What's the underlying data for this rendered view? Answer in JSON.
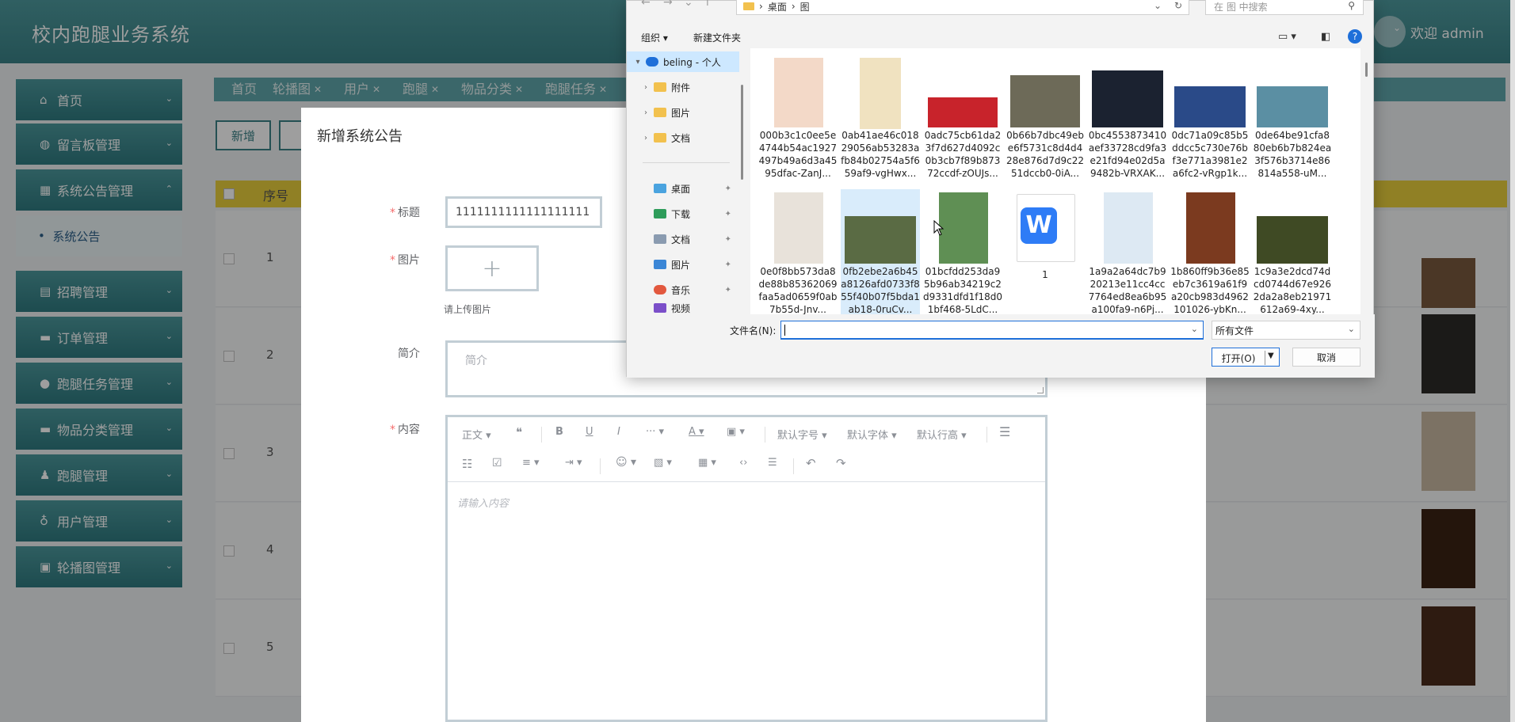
{
  "app": {
    "title": "校内跑腿业务系统",
    "welcome": "欢迎 admin"
  },
  "sidebar": {
    "items": [
      {
        "label": "首页",
        "icon": "home-icon",
        "glyph": "⌂"
      },
      {
        "label": "留言板管理",
        "icon": "chat-icon",
        "glyph": "◍"
      },
      {
        "label": "系统公告管理",
        "icon": "grid-icon",
        "glyph": "▦"
      },
      {
        "label": "招聘管理",
        "icon": "list-icon",
        "glyph": "▤"
      },
      {
        "label": "订单管理",
        "icon": "card-icon",
        "glyph": "▬"
      },
      {
        "label": "跑腿任务管理",
        "icon": "drop-icon",
        "glyph": "●"
      },
      {
        "label": "物品分类管理",
        "icon": "card-icon",
        "glyph": "▬"
      },
      {
        "label": "跑腿管理",
        "icon": "user-icon",
        "glyph": "♟"
      },
      {
        "label": "用户管理",
        "icon": "bell-icon",
        "glyph": "♁"
      },
      {
        "label": "轮播图管理",
        "icon": "image-icon",
        "glyph": "▣"
      }
    ],
    "sub_item": "系统公告"
  },
  "tabs": [
    "首页",
    "轮播图",
    "用户",
    "跑腿",
    "物品分类",
    "跑腿任务"
  ],
  "list": {
    "add_label": "新增",
    "index_header": "序号",
    "rows": [
      "1",
      "2",
      "3",
      "4",
      "5"
    ]
  },
  "dialog": {
    "title": "新增系统公告",
    "labels": {
      "title": "标题",
      "image": "图片",
      "summary": "简介",
      "content": "内容"
    },
    "required_mark": "*",
    "title_value": "1111111111111111111",
    "upload_tip": "请上传图片",
    "summary_placeholder": "简介",
    "content_placeholder": "请输入内容",
    "toolbar": {
      "paragraph": "正文",
      "font_size": "默认字号",
      "font_family": "默认字体",
      "line_height": "默认行高"
    }
  },
  "picker": {
    "breadcrumb": [
      "桌面",
      "图"
    ],
    "search_placeholder": "在 图 中搜索",
    "organize": "组织",
    "new_folder": "新建文件夹",
    "nav": [
      {
        "label": "beling - 个人",
        "type": "cloud"
      },
      {
        "label": "附件",
        "type": "folder"
      },
      {
        "label": "图片",
        "type": "folder"
      },
      {
        "label": "文档",
        "type": "folder"
      },
      {
        "label": "桌面",
        "type": "desktop"
      },
      {
        "label": "下载",
        "type": "download"
      },
      {
        "label": "文档",
        "type": "doc"
      },
      {
        "label": "图片",
        "type": "pictures"
      },
      {
        "label": "音乐",
        "type": "music"
      },
      {
        "label": "视频",
        "type": "video"
      }
    ],
    "files": [
      {
        "name": "000b3c1c0ee5e4744b54ac1927497b49a6d3a4595dfac-ZanJ...",
        "color": "#f3d9c8"
      },
      {
        "name": "0ab41ae46c01829056ab53283afb84b02754a5f659af9-vgHwx...",
        "color": "#f0e2c0"
      },
      {
        "name": "0adc75cb61da23f7d627d4092c0b3cb7f89b87372ccdf-zOUJs...",
        "color": "#c8232b"
      },
      {
        "name": "0b66b7dbc49ebe6f5731c8d4d428e876d7d9c2251dccb0-0iA...",
        "color": "#6d6a58"
      },
      {
        "name": "0bc4553873410aef33728cd9fa3e21fd94e02d5a9482b-VRXAK...",
        "color": "#1b2230"
      },
      {
        "name": "0dc71a09c85b5ddcc5c730e76bf3e771a3981e2a6fc2-vRgp1k...",
        "color": "#2a4a88"
      },
      {
        "name": "0de64be91cfa880eb6b7b824ea3f576b3714e86814a558-uM...",
        "color": "#5b8fa3"
      },
      {
        "name": "0e0f8bb573da8de88b85362069faa5ad0659f0ab7b55d-Jnv...",
        "color": "#e8e2da"
      },
      {
        "name": "0fb2ebe2a6b45a8126afd0733f855f40b07f5bda1ab18-0ruCv...",
        "color": "#5a6b44"
      },
      {
        "name": "01bcfdd253da95b96ab34219c2d9331dfd1f18d01bf468-5LdC...",
        "color": "#5f8f54"
      },
      {
        "name": "1",
        "color": "#ffffff"
      },
      {
        "name": "1a9a2a64dc7b920213e11cc4cc7764ed8ea6b95a100fa9-n6Pj...",
        "color": "#dde9f3"
      },
      {
        "name": "1b860ff9b36e85eb7c3619a61f9a20cb983d4962101026-ybKn...",
        "color": "#7b3a1f"
      },
      {
        "name": "1c9a3e2dcd74dcd0744d67e9262da2a8eb21971612a69-4xy...",
        "color": "#3f4a24"
      }
    ],
    "filename_label": "文件名(N):",
    "filename_value": "",
    "filter": "所有文件",
    "open_label": "打开(O)",
    "cancel_label": "取消"
  }
}
